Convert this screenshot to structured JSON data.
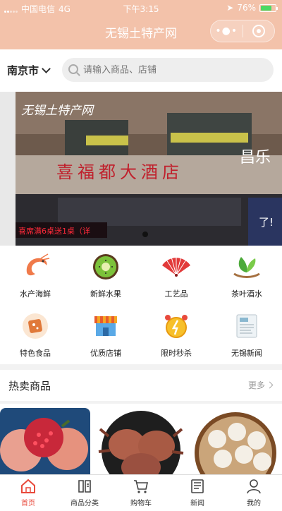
{
  "status_bar": {
    "carrier": "中国电信",
    "network": "4G",
    "time": "下午3:15",
    "battery": "76%",
    "battery_level": 0.76
  },
  "nav": {
    "title": "无锡土特产网"
  },
  "search": {
    "city": "南京市",
    "placeholder": "请输入商品、店铺"
  },
  "banner": {
    "sign_main": "无锡土特产网",
    "sign_hotel": "喜福都大酒店",
    "led_text": "喜席满6桌送1桌（详",
    "side_text": "了!",
    "side_text2": "昌乐"
  },
  "categories": [
    {
      "label": "水产海鲜",
      "icon": "shrimp-icon"
    },
    {
      "label": "新鲜水果",
      "icon": "kiwi-icon"
    },
    {
      "label": "工艺品",
      "icon": "fan-icon"
    },
    {
      "label": "茶叶酒水",
      "icon": "tea-leaf-icon"
    },
    {
      "label": "特色食品",
      "icon": "snack-icon"
    },
    {
      "label": "优质店铺",
      "icon": "shop-icon"
    },
    {
      "label": "限时秒杀",
      "icon": "alarm-clock-icon"
    },
    {
      "label": "无锡新闻",
      "icon": "news-icon"
    }
  ],
  "hot": {
    "title": "热卖商品",
    "more": "更多"
  },
  "tabs": [
    {
      "label": "首页",
      "icon": "home-icon",
      "active": true
    },
    {
      "label": "商品分类",
      "icon": "category-icon",
      "active": false
    },
    {
      "label": "购物车",
      "icon": "cart-icon",
      "active": false
    },
    {
      "label": "新闻",
      "icon": "news-icon",
      "active": false
    },
    {
      "label": "我的",
      "icon": "user-icon",
      "active": false
    }
  ],
  "colors": {
    "header": "#f3c2aa",
    "accent": "#e84a3c"
  }
}
